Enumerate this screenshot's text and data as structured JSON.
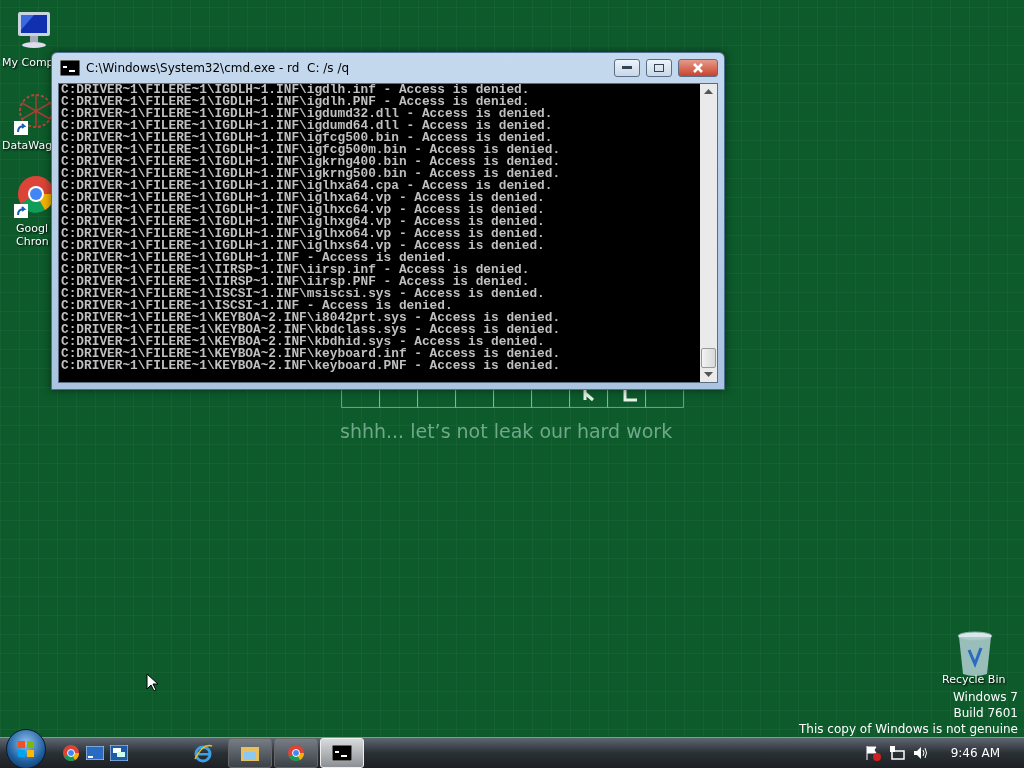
{
  "desktop_icons": [
    {
      "kind": "computer",
      "lines": [
        "My Comp"
      ],
      "shortcut": false
    },
    {
      "kind": "web",
      "lines": [
        "DataWag"
      ],
      "shortcut": true
    },
    {
      "kind": "chrome",
      "lines": [
        "Googl",
        "Chron"
      ],
      "shortcut": true
    }
  ],
  "tagline": "shhh... let’s not leak our hard work",
  "window": {
    "title": "C:\\Windows\\System32\\cmd.exe - rd  C: /s /q",
    "lines": [
      "C:DRIVER~1\\FILERE~1\\IGDLH~1.INF\\igdlh.inf - Access is denied.",
      "C:DRIVER~1\\FILERE~1\\IGDLH~1.INF\\igdlh.PNF - Access is denied.",
      "C:DRIVER~1\\FILERE~1\\IGDLH~1.INF\\igdumd32.dll - Access is denied.",
      "C:DRIVER~1\\FILERE~1\\IGDLH~1.INF\\igdumd64.dll - Access is denied.",
      "C:DRIVER~1\\FILERE~1\\IGDLH~1.INF\\igfcg500.bin - Access is denied.",
      "C:DRIVER~1\\FILERE~1\\IGDLH~1.INF\\igfcg500m.bin - Access is denied.",
      "C:DRIVER~1\\FILERE~1\\IGDLH~1.INF\\igkrng400.bin - Access is denied.",
      "C:DRIVER~1\\FILERE~1\\IGDLH~1.INF\\igkrng500.bin - Access is denied.",
      "C:DRIVER~1\\FILERE~1\\IGDLH~1.INF\\iglhxa64.cpa - Access is denied.",
      "C:DRIVER~1\\FILERE~1\\IGDLH~1.INF\\iglhxa64.vp - Access is denied.",
      "C:DRIVER~1\\FILERE~1\\IGDLH~1.INF\\iglhxc64.vp - Access is denied.",
      "C:DRIVER~1\\FILERE~1\\IGDLH~1.INF\\iglhxg64.vp - Access is denied.",
      "C:DRIVER~1\\FILERE~1\\IGDLH~1.INF\\iglhxo64.vp - Access is denied.",
      "C:DRIVER~1\\FILERE~1\\IGDLH~1.INF\\iglhxs64.vp - Access is denied.",
      "C:DRIVER~1\\FILERE~1\\IGDLH~1.INF - Access is denied.",
      "C:DRIVER~1\\FILERE~1\\IIRSP~1.INF\\iirsp.inf - Access is denied.",
      "C:DRIVER~1\\FILERE~1\\IIRSP~1.INF\\iirsp.PNF - Access is denied.",
      "C:DRIVER~1\\FILERE~1\\ISCSI~1.INF\\msiscsi.sys - Access is denied.",
      "C:DRIVER~1\\FILERE~1\\ISCSI~1.INF - Access is denied.",
      "C:DRIVER~1\\FILERE~1\\KEYBOA~2.INF\\i8042prt.sys - Access is denied.",
      "C:DRIVER~1\\FILERE~1\\KEYBOA~2.INF\\kbdclass.sys - Access is denied.",
      "C:DRIVER~1\\FILERE~1\\KEYBOA~2.INF\\kbdhid.sys - Access is denied.",
      "C:DRIVER~1\\FILERE~1\\KEYBOA~2.INF\\keyboard.inf - Access is denied.",
      "C:DRIVER~1\\FILERE~1\\KEYBOA~2.INF\\keyboard.PNF - Access is denied."
    ]
  },
  "recycle_bin": {
    "label": "Recycle Bin"
  },
  "watermark": [
    "Windows 7",
    "Build 7601",
    "This copy of Windows is not genuine"
  ],
  "taskbar": {
    "quick_launch": [
      {
        "kind": "chrome"
      },
      {
        "kind": "desktop"
      },
      {
        "kind": "switch"
      },
      {
        "kind": "ie"
      }
    ],
    "buttons": [
      {
        "kind": "explorer",
        "selected": false
      },
      {
        "kind": "chrome",
        "selected": false
      },
      {
        "kind": "cmd",
        "selected": true
      }
    ],
    "tray": [
      {
        "kind": "flag"
      },
      {
        "kind": "network"
      },
      {
        "kind": "volume"
      }
    ],
    "clock": "9:46 AM"
  }
}
